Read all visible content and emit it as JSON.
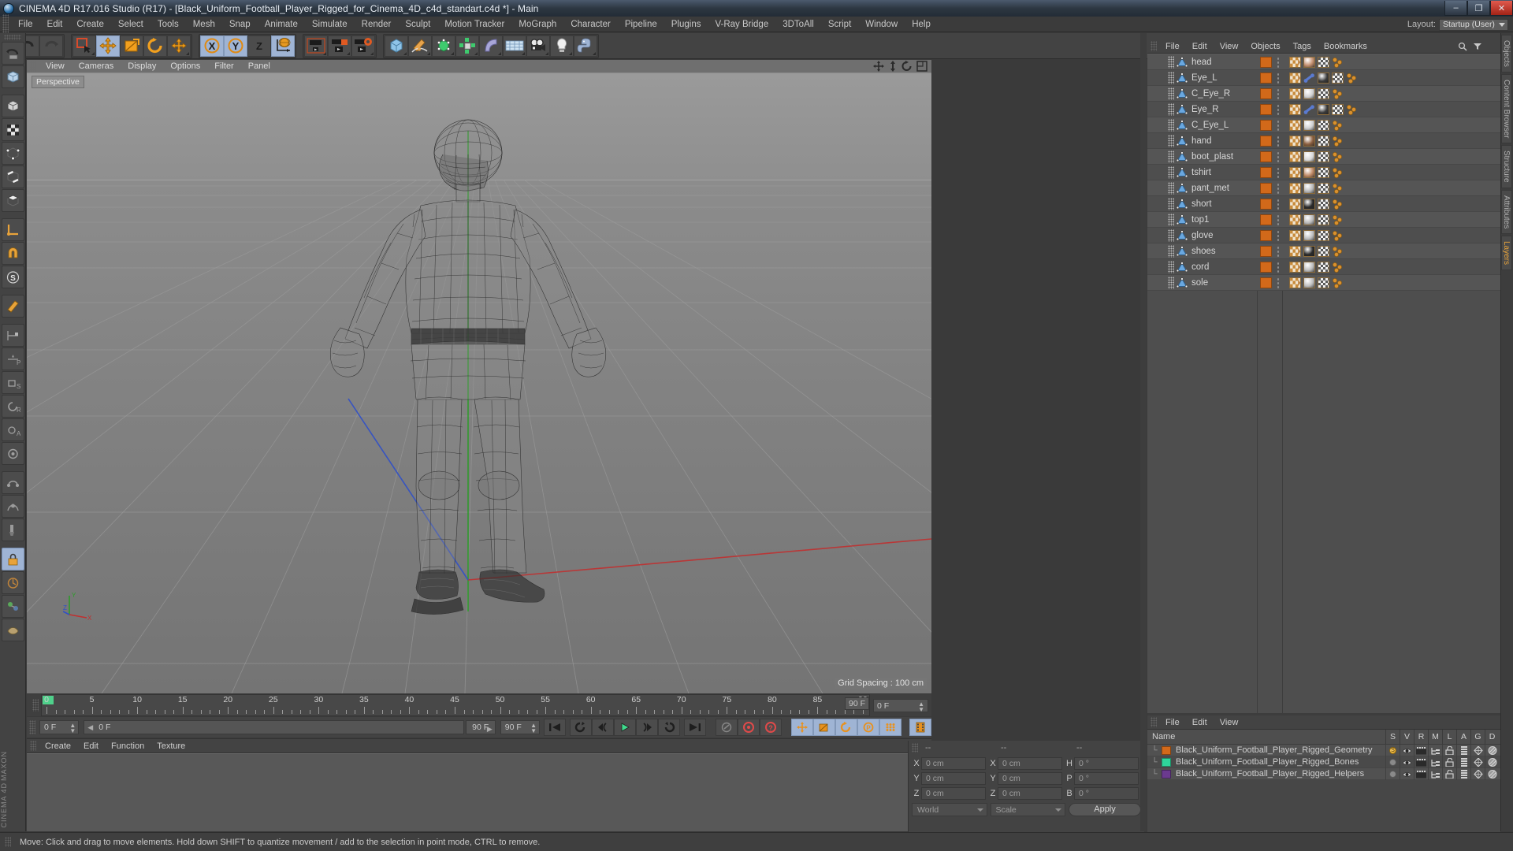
{
  "titlebar": {
    "title": "CINEMA 4D R17.016 Studio (R17) - [Black_Uniform_Football_Player_Rigged_for_Cinema_4D_c4d_standart.c4d *] - Main",
    "app_icon": "c4d-logo-icon",
    "minimize": "–",
    "maximize": "❐",
    "close": "✕"
  },
  "menubar": {
    "items": [
      {
        "label": "File"
      },
      {
        "label": "Edit"
      },
      {
        "label": "Create"
      },
      {
        "label": "Select"
      },
      {
        "label": "Tools"
      },
      {
        "label": "Mesh"
      },
      {
        "label": "Snap"
      },
      {
        "label": "Animate"
      },
      {
        "label": "Simulate"
      },
      {
        "label": "Render"
      },
      {
        "label": "Sculpt"
      },
      {
        "label": "Motion Tracker"
      },
      {
        "label": "MoGraph"
      },
      {
        "label": "Character"
      },
      {
        "label": "Pipeline"
      },
      {
        "label": "Plugins"
      },
      {
        "label": "V-Ray Bridge"
      },
      {
        "label": "3DToAll"
      },
      {
        "label": "Script"
      },
      {
        "label": "Window"
      },
      {
        "label": "Help"
      }
    ],
    "layout_label": "Layout:",
    "layout_value": "Startup (User)"
  },
  "toolbar": {
    "groups": [
      {
        "name": "history",
        "buttons": [
          {
            "name": "undo-button",
            "icon": "undo-icon",
            "selected": false
          },
          {
            "name": "redo-button",
            "icon": "redo-icon",
            "selected": false
          }
        ]
      },
      {
        "name": "transform",
        "buttons": [
          {
            "name": "live-selection-button",
            "icon": "selection-icon",
            "selected": false
          },
          {
            "name": "move-tool-button",
            "icon": "move-icon",
            "selected": true
          },
          {
            "name": "scale-tool-button",
            "icon": "scale-icon",
            "selected": false
          },
          {
            "name": "rotate-tool-button",
            "icon": "rotate-icon",
            "selected": false
          },
          {
            "name": "move-axis-button",
            "icon": "move-axis-icon",
            "selected": false
          }
        ]
      },
      {
        "name": "axis-lock",
        "buttons": [
          {
            "name": "lock-x-button",
            "icon": "x-axis-icon",
            "selected": true
          },
          {
            "name": "lock-y-button",
            "icon": "y-axis-icon",
            "selected": true
          },
          {
            "name": "lock-z-button",
            "icon": "z-axis-icon",
            "selected": false
          },
          {
            "name": "world-coordinates-button",
            "icon": "globe-axis-icon",
            "selected": true
          }
        ]
      },
      {
        "name": "render",
        "buttons": [
          {
            "name": "render-view-button",
            "icon": "render-view-icon",
            "selected": false
          },
          {
            "name": "render-to-picture-viewer-button",
            "icon": "render-picture-icon",
            "selected": false
          },
          {
            "name": "render-settings-button",
            "icon": "render-settings-icon",
            "selected": false
          }
        ]
      },
      {
        "name": "create",
        "buttons": [
          {
            "name": "cube-primitive-button",
            "icon": "cube-icon",
            "selected": false
          },
          {
            "name": "spline-pen-button",
            "icon": "pen-icon",
            "selected": false
          },
          {
            "name": "nurbs-button",
            "icon": "nurbs-cube-icon",
            "selected": false
          },
          {
            "name": "array-button",
            "icon": "array-icon",
            "selected": false
          },
          {
            "name": "deformer-button",
            "icon": "bend-deformer-icon",
            "selected": false
          },
          {
            "name": "environment-button",
            "icon": "floor-grid-icon",
            "selected": false
          },
          {
            "name": "camera-button",
            "icon": "camera-icon",
            "selected": false
          },
          {
            "name": "light-button",
            "icon": "light-bulb-icon",
            "selected": false
          },
          {
            "name": "python-button",
            "icon": "python-icon",
            "selected": false
          }
        ]
      }
    ]
  },
  "left_toolbar": {
    "buttons": [
      {
        "name": "tool-undo-view",
        "icon": "undo-view-icon",
        "selected": false
      },
      {
        "name": "tool-make-editable",
        "icon": "make-editable-icon",
        "selected": false
      },
      {
        "name": "tool-model-mode",
        "icon": "model-mode-icon",
        "selected": false
      },
      {
        "name": "tool-texture-mode",
        "icon": "texture-mode-icon",
        "selected": false
      },
      {
        "name": "tool-point-mode",
        "icon": "point-mode-icon",
        "selected": false
      },
      {
        "name": "tool-edge-mode",
        "icon": "edge-mode-icon",
        "selected": false
      },
      {
        "name": "tool-polygon-mode",
        "icon": "polygon-mode-icon",
        "selected": false
      },
      {
        "name": "tool-enable-axis",
        "icon": "axis-modify-icon",
        "selected": false
      },
      {
        "name": "tool-enable-snapping",
        "icon": "magnet-snap-icon",
        "selected": false
      },
      {
        "name": "tool-workplane",
        "icon": "workplane-icon",
        "selected": false
      },
      {
        "name": "tool-viewport-solo",
        "icon": "solo-icon",
        "selected": false
      },
      {
        "name": "tool-polygon-pen",
        "icon": "polygon-pen-icon",
        "selected": false
      },
      {
        "name": "tool-animate-layout",
        "icon": "animate-layout-icon",
        "selected": false
      },
      {
        "name": "tool-key-position",
        "icon": "key-position-icon",
        "selected": false
      },
      {
        "name": "tool-key-scale",
        "icon": "key-scale-icon",
        "selected": false
      },
      {
        "name": "tool-key-rotation",
        "icon": "key-rotation-icon",
        "selected": false
      },
      {
        "name": "tool-key-param",
        "icon": "key-param-icon",
        "selected": false
      },
      {
        "name": "tool-autokey",
        "icon": "autokey-icon",
        "selected": false
      },
      {
        "name": "tool-record-active",
        "icon": "record-active-icon",
        "selected": false
      },
      {
        "name": "tool-sculpt",
        "icon": "sculpt-icon",
        "selected": false
      },
      {
        "name": "tool-paint",
        "icon": "paint-icon",
        "selected": false
      },
      {
        "name": "tool-lock",
        "icon": "lock-icon",
        "selected": true
      },
      {
        "name": "tool-motion-clip",
        "icon": "motion-clip-icon",
        "selected": false
      },
      {
        "name": "tool-weight",
        "icon": "weight-icon",
        "selected": false
      },
      {
        "name": "tool-skin",
        "icon": "skin-icon",
        "selected": false
      }
    ]
  },
  "viewport": {
    "menu": [
      {
        "label": "View"
      },
      {
        "label": "Cameras"
      },
      {
        "label": "Display"
      },
      {
        "label": "Options"
      },
      {
        "label": "Filter"
      },
      {
        "label": "Panel"
      }
    ],
    "icons": [
      {
        "name": "pan-view-icon"
      },
      {
        "name": "zoom-view-icon"
      },
      {
        "name": "rotate-view-icon"
      },
      {
        "name": "maximize-view-icon"
      }
    ],
    "camera_tag": "Perspective",
    "grid_spacing": "Grid Spacing : 100 cm",
    "axis": {
      "x": "X",
      "y": "Y",
      "z": "Z"
    },
    "model_description": "wireframe football player in A-pose on ground grid"
  },
  "timeline": {
    "ticks": [
      0,
      5,
      10,
      15,
      20,
      25,
      30,
      35,
      40,
      45,
      50,
      55,
      60,
      65,
      70,
      75,
      80,
      85,
      90
    ],
    "start_frame": "0 F",
    "end_frame": "90 F",
    "end_field": "90 F",
    "current_frame_field": "0 F",
    "current_frame_right": "0 F",
    "preview_start": "0 F"
  },
  "animbar": {
    "left_field": "0 F",
    "current_field": "0 F",
    "end_small": "90 F",
    "end_field": "90 F",
    "transport": [
      {
        "name": "go-to-start-button",
        "icon": "skip-start-icon",
        "selected": false
      },
      {
        "name": "play-backwards-loop-button",
        "icon": "loop-back-icon",
        "selected": false
      },
      {
        "name": "previous-key-button",
        "icon": "prev-key-icon",
        "selected": false
      },
      {
        "name": "play-button",
        "icon": "play-icon",
        "selected": false
      },
      {
        "name": "next-key-button",
        "icon": "next-key-icon",
        "selected": false
      },
      {
        "name": "play-forward-loop-button",
        "icon": "loop-forward-icon",
        "selected": false
      },
      {
        "name": "go-to-end-button",
        "icon": "skip-end-icon",
        "selected": false
      }
    ],
    "record": [
      {
        "name": "autokeying-button",
        "icon": "autokey-off-icon",
        "selected": false
      },
      {
        "name": "record-active-objects-button",
        "icon": "record-red-icon",
        "selected": false
      },
      {
        "name": "keyframe-selection-button",
        "icon": "key-question-icon",
        "selected": false
      }
    ],
    "keyflags": [
      {
        "name": "key-position-toggle",
        "icon": "position-key-icon",
        "selected": true
      },
      {
        "name": "key-scale-toggle",
        "icon": "scale-key-icon",
        "selected": true
      },
      {
        "name": "key-rotation-toggle",
        "icon": "rotation-key-icon",
        "selected": true
      },
      {
        "name": "key-param-toggle",
        "icon": "param-key-icon",
        "selected": true
      },
      {
        "name": "key-pla-toggle",
        "icon": "pla-key-icon",
        "selected": true
      }
    ],
    "extra": [
      {
        "name": "timeline-view-button",
        "icon": "film-strip-icon",
        "selected": true
      }
    ]
  },
  "material_manager": {
    "menu": [
      {
        "label": "Create"
      },
      {
        "label": "Edit"
      },
      {
        "label": "Function"
      },
      {
        "label": "Texture"
      }
    ],
    "materials": []
  },
  "coordinates": {
    "header": [
      "--",
      "--",
      "--"
    ],
    "position": [
      {
        "label": "X",
        "value": "0 cm"
      },
      {
        "label": "Y",
        "value": "0 cm"
      },
      {
        "label": "Z",
        "value": "0 cm"
      }
    ],
    "size": [
      {
        "label": "X",
        "value": "0 cm"
      },
      {
        "label": "Y",
        "value": "0 cm"
      },
      {
        "label": "Z",
        "value": "0 cm"
      }
    ],
    "rotation": [
      {
        "label": "H",
        "value": "0 °"
      },
      {
        "label": "P",
        "value": "0 °"
      },
      {
        "label": "B",
        "value": "0 °"
      }
    ],
    "coord_system": "World",
    "size_mode": "Scale",
    "apply_label": "Apply"
  },
  "object_manager": {
    "menu": [
      {
        "label": "File"
      },
      {
        "label": "Edit"
      },
      {
        "label": "View"
      },
      {
        "label": "Objects"
      },
      {
        "label": "Tags"
      },
      {
        "label": "Bookmarks"
      }
    ],
    "search_icon": "search-icon",
    "objects": [
      {
        "name": "head",
        "type": "polygon-object",
        "tags": [
          "uv-tag",
          "material-head",
          "texture-tag",
          "points-tag"
        ]
      },
      {
        "name": "Eye_L",
        "type": "polygon-object",
        "tags": [
          "uv-tag",
          "bone-tag",
          "material-eye",
          "texture-tag",
          "points-tag"
        ]
      },
      {
        "name": "C_Eye_R",
        "type": "polygon-object",
        "tags": [
          "uv-tag",
          "material-glass",
          "texture-tag",
          "points-tag"
        ]
      },
      {
        "name": "Eye_R",
        "type": "polygon-object",
        "tags": [
          "uv-tag",
          "bone-tag",
          "material-eye",
          "texture-tag",
          "points-tag"
        ]
      },
      {
        "name": "C_Eye_L",
        "type": "polygon-object",
        "tags": [
          "uv-tag",
          "material-glass",
          "texture-tag",
          "points-tag"
        ]
      },
      {
        "name": "hand",
        "type": "polygon-object",
        "tags": [
          "uv-tag",
          "material-skin",
          "texture-tag",
          "points-tag"
        ]
      },
      {
        "name": "boot_plast",
        "type": "polygon-object",
        "tags": [
          "uv-tag",
          "material-plastic",
          "texture-tag",
          "points-tag"
        ]
      },
      {
        "name": "tshirt",
        "type": "polygon-object",
        "tags": [
          "uv-tag",
          "material-cloth",
          "texture-tag",
          "points-tag"
        ]
      },
      {
        "name": "pant_met",
        "type": "polygon-object",
        "tags": [
          "uv-tag",
          "material-metal",
          "texture-tag",
          "points-tag"
        ]
      },
      {
        "name": "short",
        "type": "polygon-object",
        "tags": [
          "uv-tag",
          "material-dark",
          "texture-tag",
          "points-tag"
        ]
      },
      {
        "name": "top1",
        "type": "polygon-object",
        "tags": [
          "uv-tag",
          "material-metal",
          "texture-tag",
          "points-tag"
        ]
      },
      {
        "name": "glove",
        "type": "polygon-object",
        "tags": [
          "uv-tag",
          "material-grey",
          "texture-tag",
          "points-tag"
        ]
      },
      {
        "name": "shoes",
        "type": "polygon-object",
        "tags": [
          "uv-tag",
          "material-dark",
          "texture-tag",
          "points-tag"
        ]
      },
      {
        "name": "cord",
        "type": "polygon-object",
        "tags": [
          "uv-tag",
          "material-grey",
          "texture-tag",
          "points-tag"
        ]
      },
      {
        "name": "sole",
        "type": "polygon-object",
        "tags": [
          "uv-tag",
          "material-grey",
          "texture-tag",
          "points-tag"
        ]
      }
    ]
  },
  "layer_manager": {
    "menu": [
      {
        "label": "File"
      },
      {
        "label": "Edit"
      },
      {
        "label": "View"
      }
    ],
    "name_column": "Name",
    "columns": [
      "S",
      "V",
      "R",
      "M",
      "L",
      "A",
      "G",
      "D"
    ],
    "layers": [
      {
        "name": "Black_Uniform_Football_Player_Rigged_Geometry",
        "color": "#d2691a",
        "solo": true
      },
      {
        "name": "Black_Uniform_Football_Player_Rigged_Bones",
        "color": "#2fd69b",
        "solo": false
      },
      {
        "name": "Black_Uniform_Football_Player_Rigged_Helpers",
        "color": "#6b3a8f",
        "solo": false
      }
    ]
  },
  "edge_tabs": [
    {
      "label": "Objects",
      "active": false
    },
    {
      "label": "Content Browser",
      "active": false
    },
    {
      "label": "Structure",
      "active": false
    },
    {
      "label": "Attributes",
      "active": false
    },
    {
      "label": "Layers",
      "active": true
    }
  ],
  "statusbar": {
    "message": "Move: Click and drag to move elements. Hold down SHIFT to quantize movement / add to the selection in point mode, CTRL to remove."
  },
  "branding": {
    "maxon": "MAXON",
    "product": "CINEMA 4D"
  },
  "colors": {
    "accent_orange": "#d2691a",
    "selection_blue": "#9fb4d4",
    "panel_bg": "#434343",
    "viewport_bg": "#7d7d7d",
    "green_axis": "#35a02b",
    "red_axis": "#c02b2b",
    "blue_axis": "#2b4fc0"
  }
}
